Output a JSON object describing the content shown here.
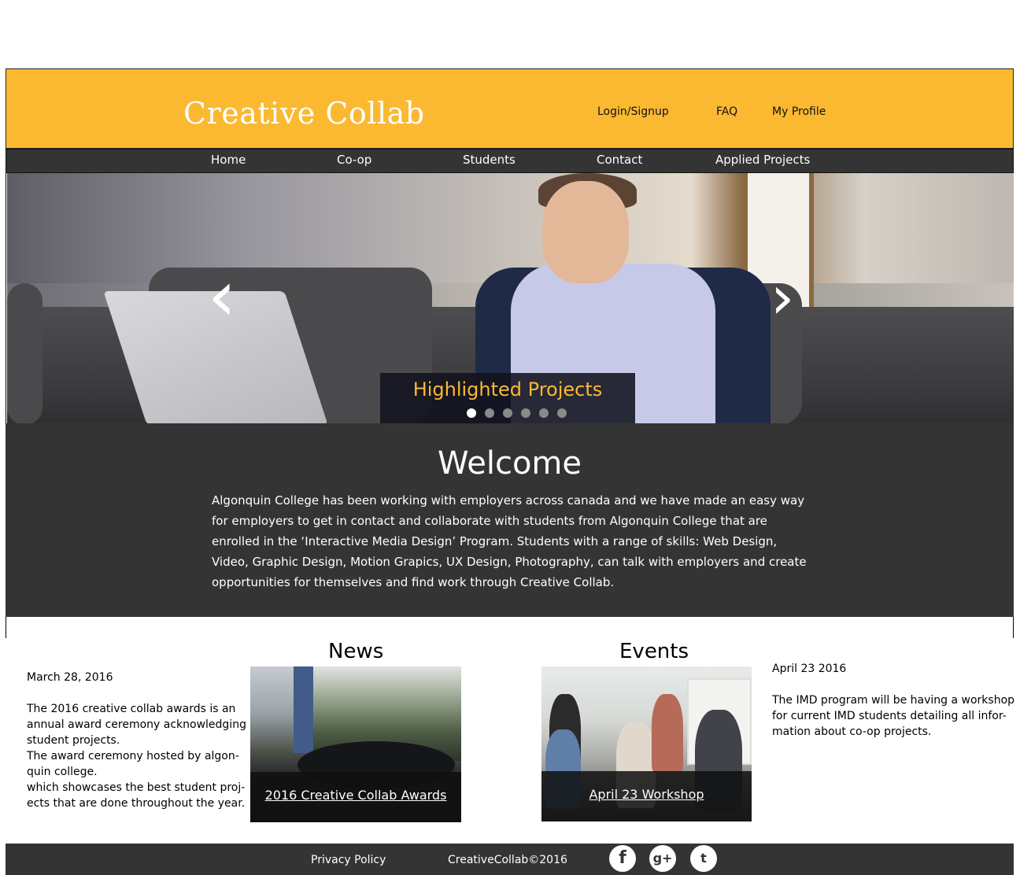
{
  "header": {
    "logo": "Creative Collab",
    "links": {
      "login": "Login/Signup",
      "faq": "FAQ",
      "profile": "My Profile"
    }
  },
  "nav": {
    "home": "Home",
    "coop": "Co-op",
    "students": "Students",
    "contact": "Contact",
    "applied": "Applied Projects"
  },
  "hero": {
    "caption": "Highlighted Projects",
    "prev_icon": "chevron-left-icon",
    "next_icon": "chevron-right-icon",
    "slide_count": 6,
    "active_slide": 1
  },
  "welcome": {
    "title": "Welcome",
    "body": "Algonquin College has been working with employers across canada and we have made an easy way for employers to get in contact and collaborate with students from Algonquin College that are enrolled in the ‘Interactive Media Design’ Program. Students with a range of skills: Web Design, Video, Graphic Design, Motion Grapics, UX Design, Photography, can talk with employers and create opportunities for themselves and find work through Creative Collab."
  },
  "news": {
    "title": "News",
    "date": "March 28, 2016",
    "lines": [
      "The 2016 creative collab awards is an",
      "annual award ceremony acknowledging",
      "student projects.",
      "The award ceremony hosted by algon-",
      "quin college.",
      "which showcases the best student proj-",
      "ects that are done throughout the year."
    ],
    "card_label": "2016 Creative Collab Awards"
  },
  "events": {
    "title": "Events",
    "date": "April  23 2016",
    "lines": [
      "The IMD program will be having a workshop",
      "for current IMD students detailing all infor-",
      "mation about co-op projects."
    ],
    "card_label": "April 23 Workshop"
  },
  "footer": {
    "privacy": "Privacy Policy",
    "copyright": "CreativeCollab©2016",
    "social": [
      {
        "icon": "facebook-icon",
        "glyph": "f"
      },
      {
        "icon": "google-plus-icon",
        "glyph": "g+"
      },
      {
        "icon": "twitter-icon",
        "glyph": "t"
      }
    ]
  },
  "colors": {
    "accent": "#fbb931",
    "dark": "#343434",
    "white": "#ffffff"
  }
}
